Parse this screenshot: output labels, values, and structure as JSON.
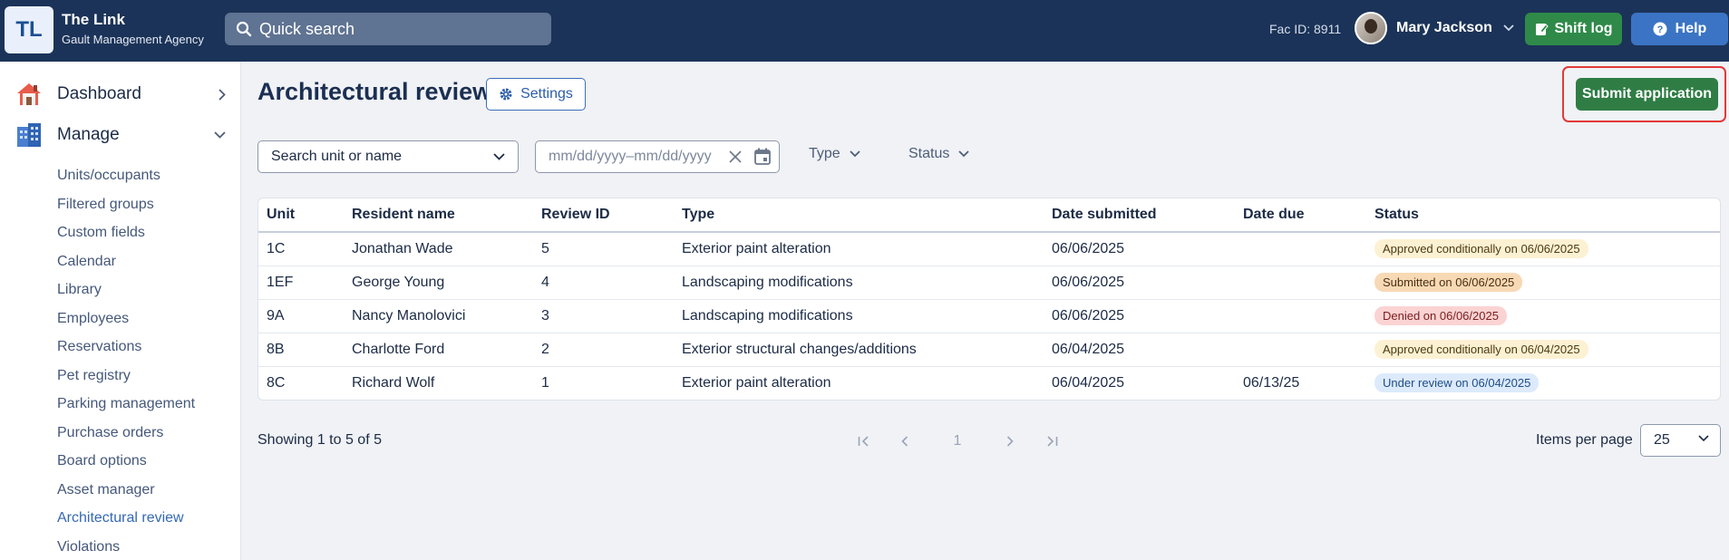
{
  "header": {
    "logo": "TL",
    "app_name": "The Link",
    "org_name": "Gault Management Agency",
    "search_placeholder": "Quick search",
    "fac_id": "Fac ID: 8911",
    "user_name": "Mary Jackson",
    "shift_log_label": "Shift log",
    "help_label": "Help",
    "colors": {
      "bar": "#1b3358",
      "shift": "#2f8a49",
      "help": "#3b74c4"
    }
  },
  "sidebar": {
    "dashboard_label": "Dashboard",
    "manage_label": "Manage",
    "items": [
      "Units/occupants",
      "Filtered groups",
      "Custom fields",
      "Calendar",
      "Library",
      "Employees",
      "Reservations",
      "Pet registry",
      "Parking management",
      "Purchase orders",
      "Board options",
      "Asset manager",
      "Architectural review",
      "Violations"
    ],
    "active_item": "Architectural review"
  },
  "page": {
    "title": "Architectural review",
    "settings_label": "Settings",
    "submit_label": "Submit application",
    "filters": {
      "unit_placeholder": "Search unit or name",
      "date_placeholder": "mm/dd/yyyy–mm/dd/yyyy",
      "type_label": "Type",
      "status_label": "Status"
    }
  },
  "table": {
    "columns": [
      "Unit",
      "Resident name",
      "Review ID",
      "Type",
      "Date submitted",
      "Date due",
      "Status"
    ],
    "rows": [
      {
        "unit": "1C",
        "resident": "Jonathan Wade",
        "review_id": "5",
        "type": "Exterior paint alteration",
        "submitted": "06/06/2025",
        "due": "",
        "status": "Approved conditionally on 06/06/2025",
        "status_kind": "approved"
      },
      {
        "unit": "1EF",
        "resident": "George Young",
        "review_id": "4",
        "type": "Landscaping modifications",
        "submitted": "06/06/2025",
        "due": "",
        "status": "Submitted on 06/06/2025",
        "status_kind": "submitted"
      },
      {
        "unit": "9A",
        "resident": "Nancy Manolovici",
        "review_id": "3",
        "type": "Landscaping modifications",
        "submitted": "06/06/2025",
        "due": "",
        "status": "Denied on 06/06/2025",
        "status_kind": "denied"
      },
      {
        "unit": "8B",
        "resident": "Charlotte Ford",
        "review_id": "2",
        "type": "Exterior structural changes/additions",
        "submitted": "06/04/2025",
        "due": "",
        "status": "Approved conditionally on 06/04/2025",
        "status_kind": "approved"
      },
      {
        "unit": "8C",
        "resident": "Richard Wolf",
        "review_id": "1",
        "type": "Exterior paint alteration",
        "submitted": "06/04/2025",
        "due": "06/13/25",
        "status": "Under review on 06/04/2025",
        "status_kind": "review"
      }
    ],
    "status_colors": {
      "approved": {
        "bg": "#fdf1d3",
        "fg": "#4a3a12"
      },
      "submitted": {
        "bg": "#f8d9b5",
        "fg": "#4a2f12"
      },
      "denied": {
        "bg": "#fbd3d3",
        "fg": "#7a1d1d"
      },
      "review": {
        "bg": "#dceafb",
        "fg": "#1f4d86"
      }
    }
  },
  "pagination": {
    "showing_text": "Showing 1 to 5 of 5",
    "current_page": "1",
    "items_per_page_label": "Items per page",
    "items_per_page": "25"
  }
}
